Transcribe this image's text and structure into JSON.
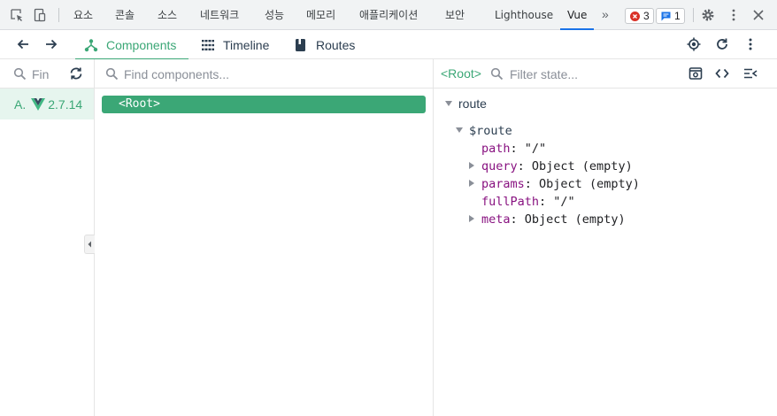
{
  "devtools": {
    "tabs": [
      "요소",
      "콘솔",
      "소스",
      "네트워크",
      "성능",
      "메모리",
      "애플리케이션",
      "보안",
      "Lighthouse",
      "Vue"
    ],
    "active_tab": "Vue",
    "more_tabs": "»",
    "errors_count": "3",
    "messages_count": "1",
    "colors": {
      "accent": "#1a73e8",
      "error": "#d93025",
      "message": "#1a73e8"
    }
  },
  "vue_toolbar": {
    "tabs": [
      {
        "label": "Components",
        "icon": "components-tree-icon"
      },
      {
        "label": "Timeline",
        "icon": "timeline-icon"
      },
      {
        "label": "Routes",
        "icon": "routes-book-icon"
      }
    ],
    "active_tab": "Components",
    "accent": "#3ba776"
  },
  "apps": {
    "search_placeholder": "Fin",
    "items": [
      {
        "name": "A.",
        "version": "2.7.14"
      }
    ]
  },
  "components": {
    "search_placeholder": "Find components...",
    "tree": [
      {
        "label": "<Root>"
      }
    ]
  },
  "inspector": {
    "selected": "<Root>",
    "search_placeholder": "Filter state...",
    "sections": [
      {
        "title": "route",
        "entries": [
          {
            "key": "$route",
            "children": [
              {
                "key": "path",
                "value": "\"/\"",
                "expandable": false
              },
              {
                "key": "query",
                "value": "Object (empty)",
                "expandable": true
              },
              {
                "key": "params",
                "value": "Object (empty)",
                "expandable": true
              },
              {
                "key": "fullPath",
                "value": "\"/\"",
                "expandable": false
              },
              {
                "key": "meta",
                "value": "Object (empty)",
                "expandable": true
              }
            ]
          }
        ]
      }
    ]
  }
}
